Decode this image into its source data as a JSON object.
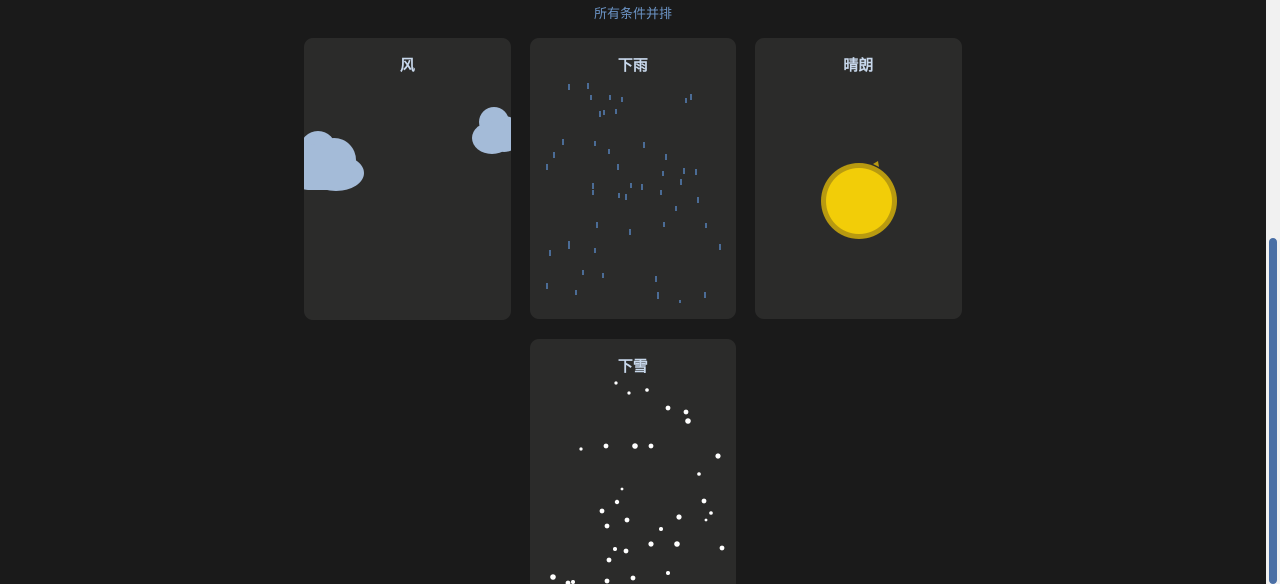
{
  "header": {
    "subtitle": "所有条件并排"
  },
  "cards": {
    "wind": {
      "title": "风"
    },
    "rain": {
      "title": "下雨"
    },
    "sunny": {
      "title": "晴朗"
    },
    "snow": {
      "title": "下雪"
    }
  },
  "colors": {
    "background": "#1a1a1a",
    "card": "#2b2b2a",
    "title": "#c8d8ec",
    "accent": "#6b93c4",
    "cloud": "#a4bbd8",
    "rain": "#5d8fd0",
    "sun": "#f2cd08",
    "sun_rim": "#b89a10",
    "snow": "#ffffff",
    "scroll_thumb": "#4a6fa5"
  },
  "icons": {
    "wind": [
      "cloud-icon",
      "cloud-icon"
    ],
    "sunny": "sun-icon",
    "rain": "rain-drop",
    "snow": "snowflake"
  }
}
